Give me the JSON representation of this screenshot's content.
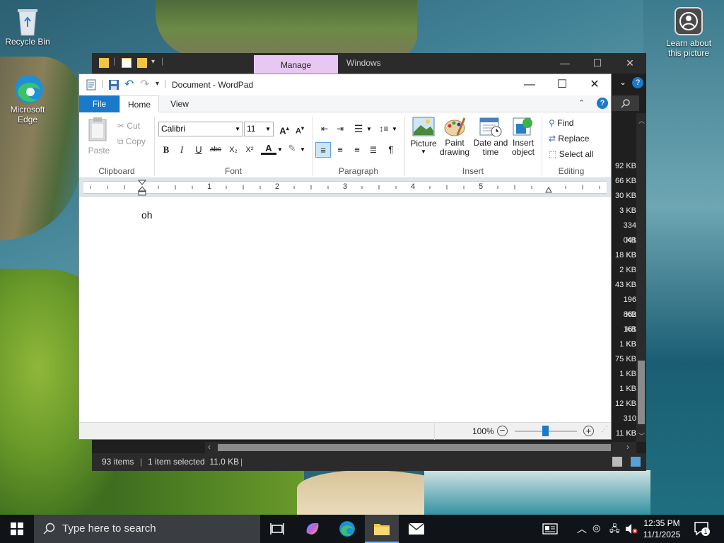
{
  "desktop": {
    "icons": [
      {
        "label": "Recycle Bin"
      },
      {
        "label": "Microsoft Edge"
      },
      {
        "label": "Learn about this picture"
      }
    ]
  },
  "explorer": {
    "tabs": {
      "manage": "Manage",
      "windows": "Windows"
    },
    "status": {
      "items": "93 items",
      "selected": "1 item selected  11.0 KB"
    },
    "sizes": [
      "92 KB",
      "66 KB",
      "30 KB",
      "3 KB",
      "334 KB",
      "041 KB",
      "18 KB",
      "2 KB",
      "43 KB",
      "196 KB",
      "862 KB",
      "161 KB",
      "1 KB",
      "75 KB",
      "1 KB",
      "1 KB",
      "12 KB",
      "310 KB",
      "11 KB"
    ]
  },
  "wordpad": {
    "title": "Document - WordPad",
    "tabs": {
      "file": "File",
      "home": "Home",
      "view": "View"
    },
    "clipboard": {
      "paste": "Paste",
      "cut": "Cut",
      "copy": "Copy",
      "label": "Clipboard"
    },
    "font": {
      "family": "Calibri",
      "size": "11",
      "label": "Font"
    },
    "paragraph": {
      "label": "Paragraph"
    },
    "insert": {
      "picture": "Picture",
      "paint": "Paint drawing",
      "datetime": "Date and time",
      "object": "Insert object",
      "label": "Insert"
    },
    "editing": {
      "find": "Find",
      "replace": "Replace",
      "select_all": "Select all",
      "label": "Editing"
    },
    "ruler_numbers": [
      "1",
      "2",
      "3",
      "4",
      "5"
    ],
    "document_text": "oh",
    "zoom": "100%"
  },
  "taskbar": {
    "search_placeholder": "Type here to search",
    "time": "12:35 PM",
    "date": "11/1/2025",
    "notification_count": "1"
  }
}
